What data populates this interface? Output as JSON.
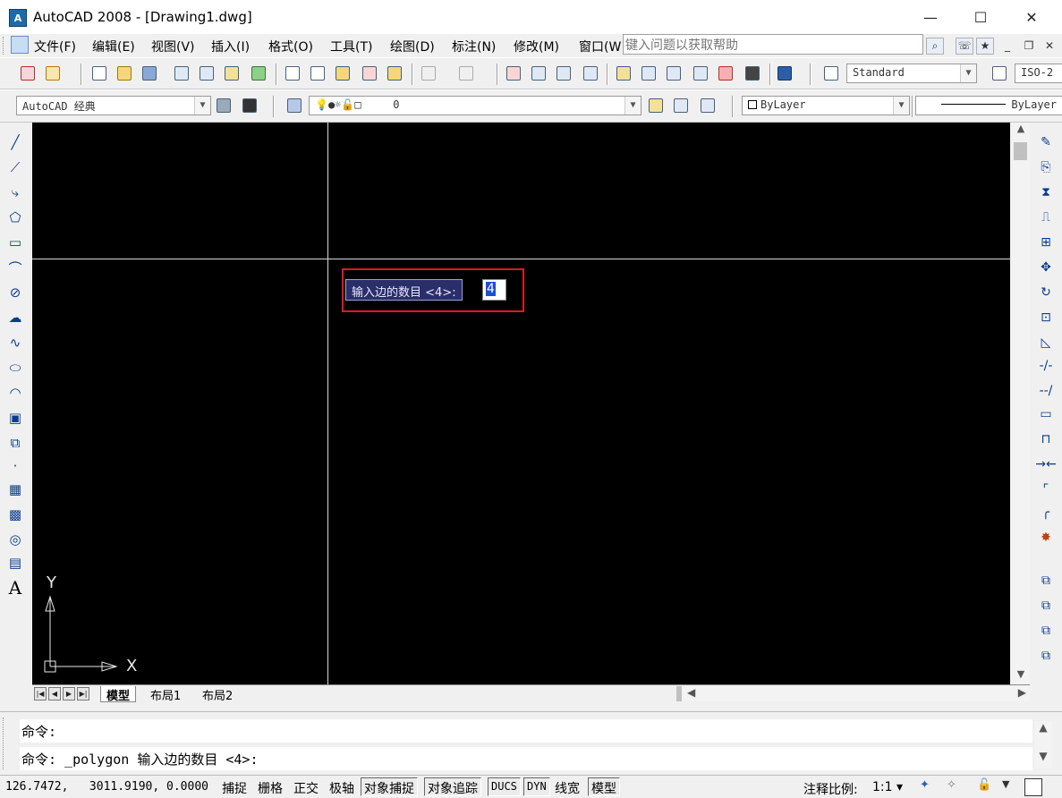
{
  "window": {
    "title": "AutoCAD 2008 - [Drawing1.dwg]",
    "app_icon_text": "A",
    "minimize": "—",
    "maximize": "☐",
    "close": "✕"
  },
  "menu": {
    "items": [
      "文件(F)",
      "编辑(E)",
      "视图(V)",
      "插入(I)",
      "格式(O)",
      "工具(T)",
      "绘图(D)",
      "标注(N)",
      "修改(M)",
      "窗口(W"
    ],
    "help_placeholder": "键入问题以获取帮助",
    "doc_min": "_",
    "doc_restore": "❐",
    "doc_close": "✕"
  },
  "toolbar": {
    "text_style": "Standard",
    "dim_style": "ISO-2",
    "workspace": "AutoCAD 经典",
    "layer_value": "0",
    "color": "ByLayer",
    "linetype": "ByLayer"
  },
  "canvas": {
    "background": "#000000",
    "dynamic_prompt": "输入边的数目 <4>:",
    "dynamic_input_value": "4",
    "highlight_color": "#e0191e",
    "ucs_x": "X",
    "ucs_y": "Y"
  },
  "tabs": {
    "items": [
      "模型",
      "布局1",
      "布局2"
    ],
    "active": "模型"
  },
  "command": {
    "line1": "命令:",
    "line2": "命令: _polygon 输入边的数目 <4>:"
  },
  "status": {
    "coords": "126.7472,   3011.9190, 0.0000",
    "buttons": [
      "捕捉",
      "栅格",
      "正交",
      "极轴",
      "对象捕捉",
      "对象追踪",
      "DUCS",
      "DYN",
      "线宽",
      "模型"
    ],
    "annotation_scale_label": "注释比例:",
    "annotation_scale_value": "1:1 ▾"
  }
}
